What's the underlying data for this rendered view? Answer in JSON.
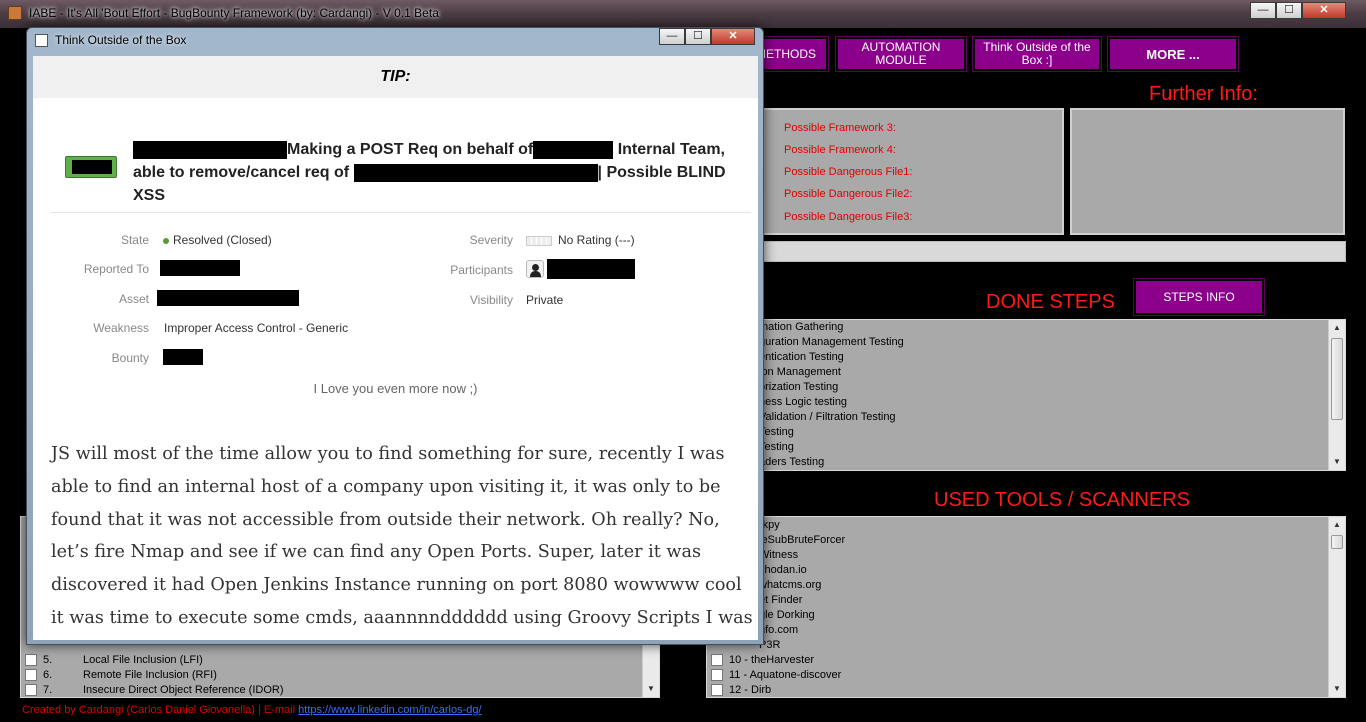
{
  "window": {
    "title": "IABE - It's All 'Bout Effort - BugBounty Framework (by: Cardangi) - V 0.1 Beta",
    "minimize": "—",
    "maximize": "☐",
    "close": "✕"
  },
  "nav": {
    "methods": "METHODS",
    "automation_module": "AUTOMATION MODULE",
    "think_outside": "Think Outside of the Box :]",
    "more": "MORE ..."
  },
  "further_info": {
    "title": "Further Info:",
    "labels": [
      "Possible Framework 3:",
      "Possible Framework 4:",
      "Possible Dangerous File1:",
      "Possible Dangerous File2:",
      "Possible Dangerous File3:"
    ]
  },
  "done_steps": {
    "title": "DONE STEPS",
    "button": "STEPS INFO",
    "items": [
      "mation Gathering",
      "guration Management Testing",
      "entication Testing",
      "ion Management",
      "orization Testing",
      "ness Logic testing",
      "Validation / Filtration Testing",
      "Testing",
      "Testing",
      "aders Testing"
    ]
  },
  "used_tools": {
    "title": "USED TOOLS / SCANNERS",
    "items_partial": [
      "-kpy",
      "leSubBruteForcer",
      "Witness",
      "shodan.io",
      "whatcms.org",
      "et Finder",
      "gle Dorking",
      "nfo.com",
      "P3R"
    ],
    "items_full": [
      "10 - theHarvester",
      "11 - Aquatone-discover",
      "12 - Dirb"
    ]
  },
  "vuln_list": {
    "items": [
      {
        "num": "5.",
        "name": "Local File Inclusion (LFI)"
      },
      {
        "num": "6.",
        "name": "Remote File Inclusion (RFI)"
      },
      {
        "num": "7.",
        "name": "Insecure Direct Object Reference (IDOR)"
      }
    ]
  },
  "footer": {
    "text": "Created by Cardangi (Carlos Daniel Giovanella) | E-mail",
    "link": "https://www.linkedin.com/in/carlos-dg/"
  },
  "dialog": {
    "title": "Think Outside of the Box",
    "tip": "TIP:",
    "report": {
      "headline_a": "Making a POST Req on behalf of",
      "headline_b": "Internal Team, able to remove/cancel req of",
      "headline_c": "| Possible BLIND XSS",
      "state_label": "State",
      "state_value": "Resolved (Closed)",
      "reported_label": "Reported To",
      "asset_label": "Asset",
      "weakness_label": "Weakness",
      "weakness_value": "Improper Access Control - Generic",
      "bounty_label": "Bounty",
      "severity_label": "Severity",
      "severity_value": "No Rating (---)",
      "participants_label": "Participants",
      "visibility_label": "Visibility",
      "visibility_value": "Private"
    },
    "love": "I Love you even more now ;)",
    "body": "JS will most of the time allow you to find something for sure, recently I was able to find an internal host of a company upon visiting it, it was only to be found that it was not accessible from outside their network. Oh really? No, let’s fire Nmap and see if we can find any Open Ports. Super, later it was discovered it had Open Jenkins Instance running on port 8080 wowwww cool it was time to execute some cmds, aaannnndddddd using Groovy Scripts I was able to execute a cmd on the server. Woohoo!"
  },
  "colors": {
    "accent_purple": "#8b008b",
    "title_red": "#ff1a1a",
    "panel_gray": "#a9a9a9"
  }
}
